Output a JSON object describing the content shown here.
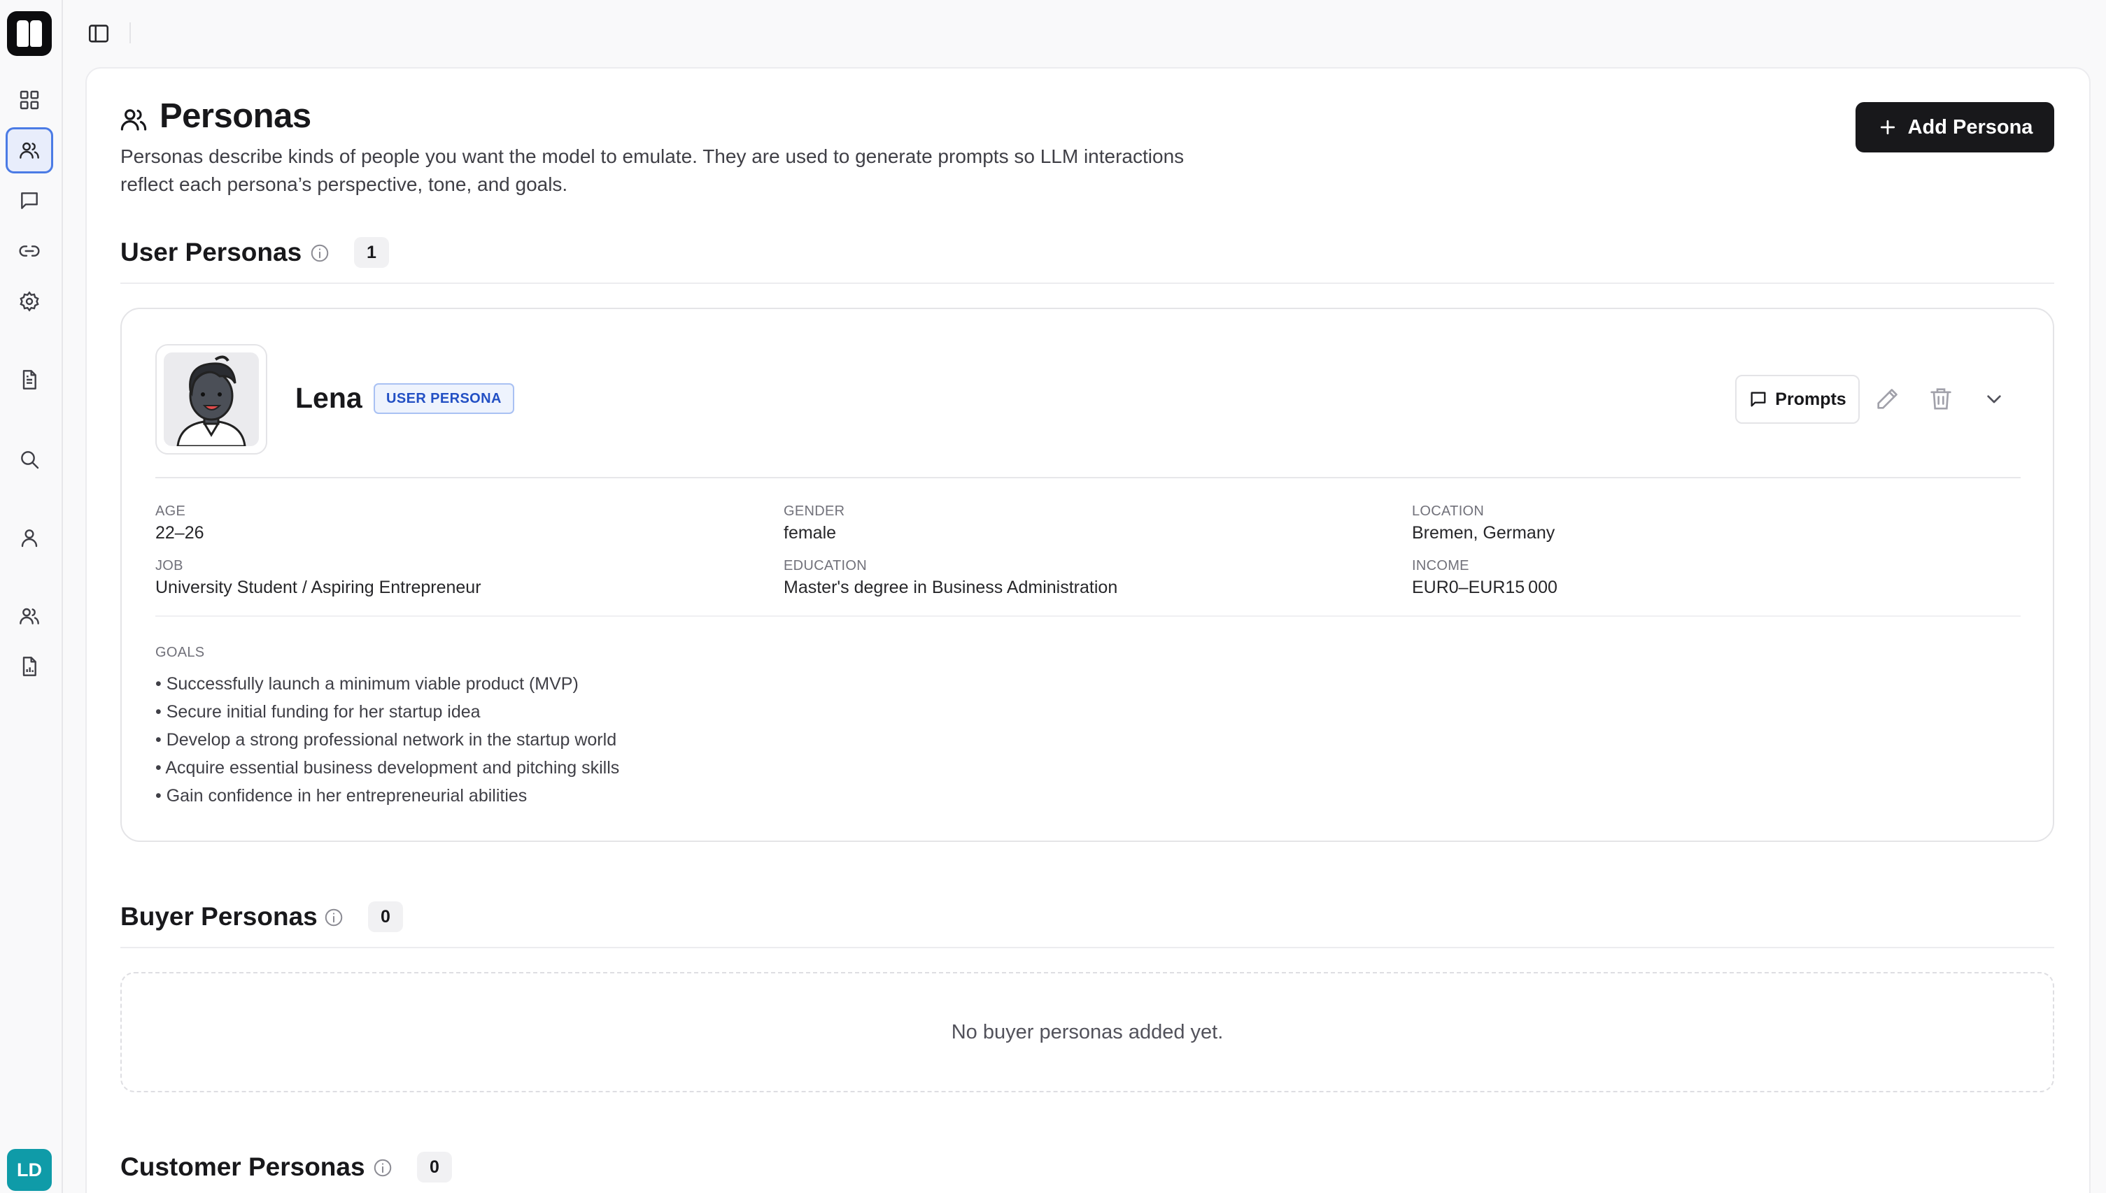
{
  "sidebar": {
    "user_initials": "LD"
  },
  "page": {
    "title": "Personas",
    "description": "Personas describe kinds of people you want the model to emulate. They are used to generate prompts so LLM interactions reflect each persona’s perspective, tone, and goals.",
    "add_button": "Add Persona"
  },
  "user_personas": {
    "title": "User Personas",
    "count": "1",
    "persona": {
      "name": "Lena",
      "badge": "USER PERSONA",
      "prompts_label": "Prompts",
      "fields": {
        "age_label": "AGE",
        "age": "22–26",
        "gender_label": "GENDER",
        "gender": "female",
        "location_label": "LOCATION",
        "location": "Bremen, Germany",
        "job_label": "JOB",
        "job": "University Student / Aspiring Entrepreneur",
        "education_label": "EDUCATION",
        "education": "Master's degree in Business Administration",
        "income_label": "INCOME",
        "income": "EUR0–EUR15 000"
      },
      "goals_label": "GOALS",
      "goals": [
        "• Successfully launch a minimum viable product (MVP)",
        "• Secure initial funding for her startup idea",
        "• Develop a strong professional network in the startup world",
        "• Acquire essential business development and pitching skills",
        "• Gain confidence in her entrepreneurial abilities"
      ]
    }
  },
  "buyer_personas": {
    "title": "Buyer Personas",
    "count": "0",
    "empty_text": "No buyer personas added yet."
  },
  "customer_personas": {
    "title": "Customer Personas",
    "count": "0"
  }
}
